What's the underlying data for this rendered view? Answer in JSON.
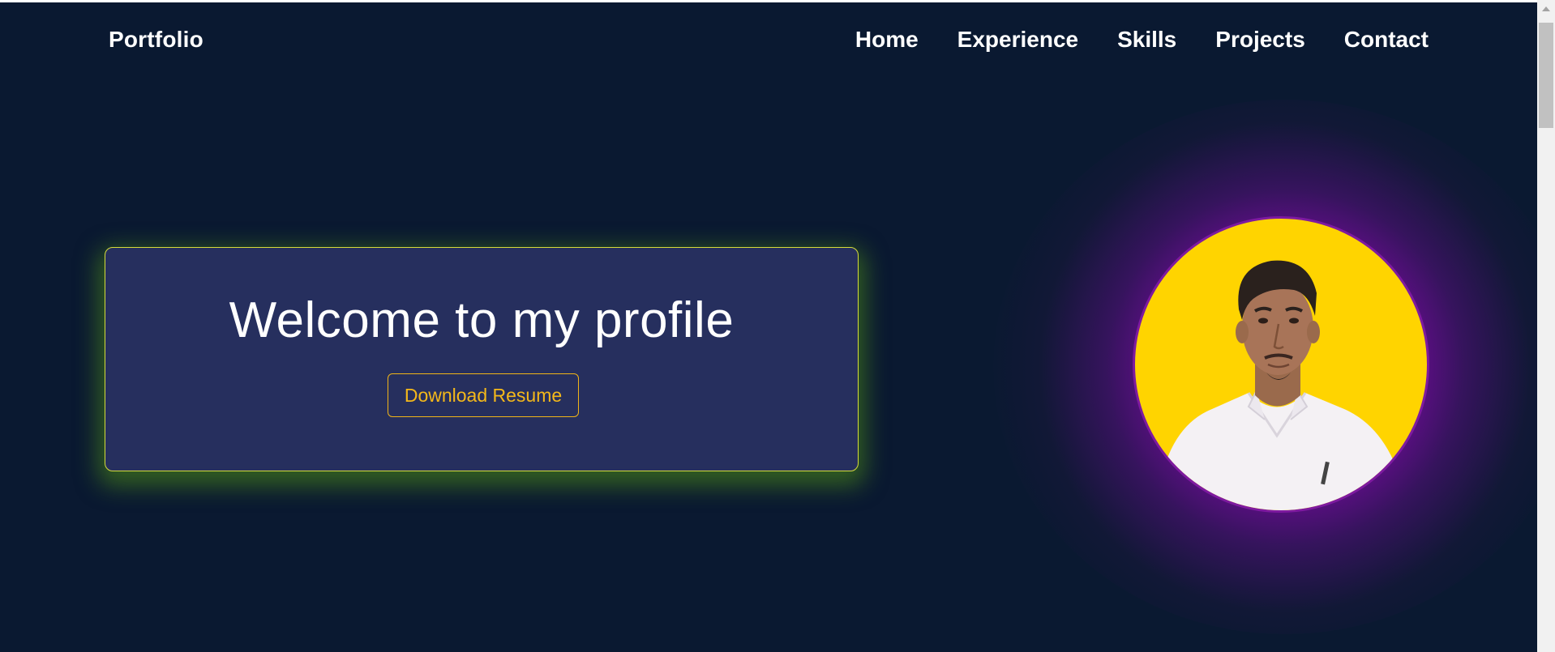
{
  "navbar": {
    "brand": "Portfolio",
    "links": [
      "Home",
      "Experience",
      "Skills",
      "Projects",
      "Contact"
    ]
  },
  "hero": {
    "title": "Welcome to my profile",
    "button_label": "Download Resume"
  },
  "profile": {
    "avatar_icon": "profile-photo"
  },
  "colors": {
    "background": "#0a1931",
    "card": "#262f5e",
    "card_border": "#d6dc3a",
    "card_glow": "#549814",
    "accent": "#f4b81a",
    "avatar_bg": "#ffd400",
    "avatar_glow": "#960abe"
  },
  "icons": {
    "scroll_up": "scroll-up-arrow-icon"
  }
}
